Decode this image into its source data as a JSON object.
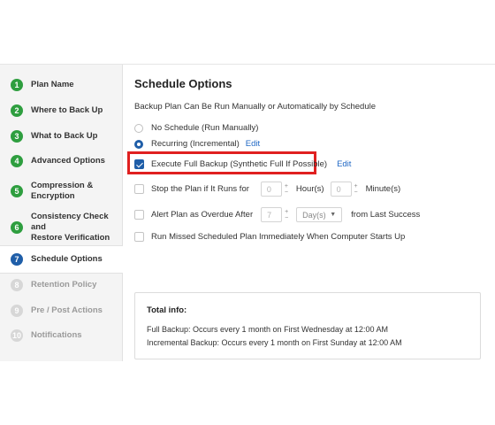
{
  "sidebar": {
    "steps": [
      {
        "num": "1",
        "label": "Plan Name",
        "state": "done"
      },
      {
        "num": "2",
        "label": "Where to Back Up",
        "state": "done"
      },
      {
        "num": "3",
        "label": "What to Back Up",
        "state": "done"
      },
      {
        "num": "4",
        "label": "Advanced Options",
        "state": "done"
      },
      {
        "num": "5",
        "label": "Compression &",
        "label2": "Encryption",
        "state": "done"
      },
      {
        "num": "6",
        "label": "Consistency Check and",
        "label2": "Restore Verification",
        "state": "done"
      },
      {
        "num": "7",
        "label": "Schedule Options",
        "state": "current"
      },
      {
        "num": "8",
        "label": "Retention Policy",
        "state": "todo"
      },
      {
        "num": "9",
        "label": "Pre / Post Actions",
        "state": "todo"
      },
      {
        "num": "10",
        "label": "Notifications",
        "state": "todo"
      }
    ]
  },
  "main": {
    "title": "Schedule Options",
    "subtitle": "Backup Plan Can Be Run Manually or Automatically by Schedule",
    "options": {
      "no_schedule": "No Schedule (Run Manually)",
      "recurring": "Recurring (Incremental)",
      "recurring_edit": "Edit",
      "full_backup": "Execute Full Backup (Synthetic Full If Possible)",
      "full_backup_edit": "Edit",
      "stop_plan": "Stop the Plan if It Runs for",
      "stop_hours_value": "0",
      "hours_label": "Hour(s)",
      "stop_minutes_value": "0",
      "minutes_label": "Minute(s)",
      "alert_overdue": "Alert Plan as Overdue After",
      "alert_value": "7",
      "alert_unit": "Day(s)",
      "alert_suffix": "from Last Success",
      "run_missed": "Run Missed Scheduled Plan Immediately When Computer Starts Up"
    },
    "total_info": {
      "heading": "Total info:",
      "full": "Full Backup: Occurs every 1 month on First Wednesday at 12:00 AM",
      "incremental": "Incremental Backup: Occurs every 1 month on First Sunday at 12:00 AM"
    }
  },
  "colors": {
    "done": "#2e9e3f",
    "current": "#1f5ea8",
    "highlight": "#e02020",
    "link": "#1f67c4"
  }
}
